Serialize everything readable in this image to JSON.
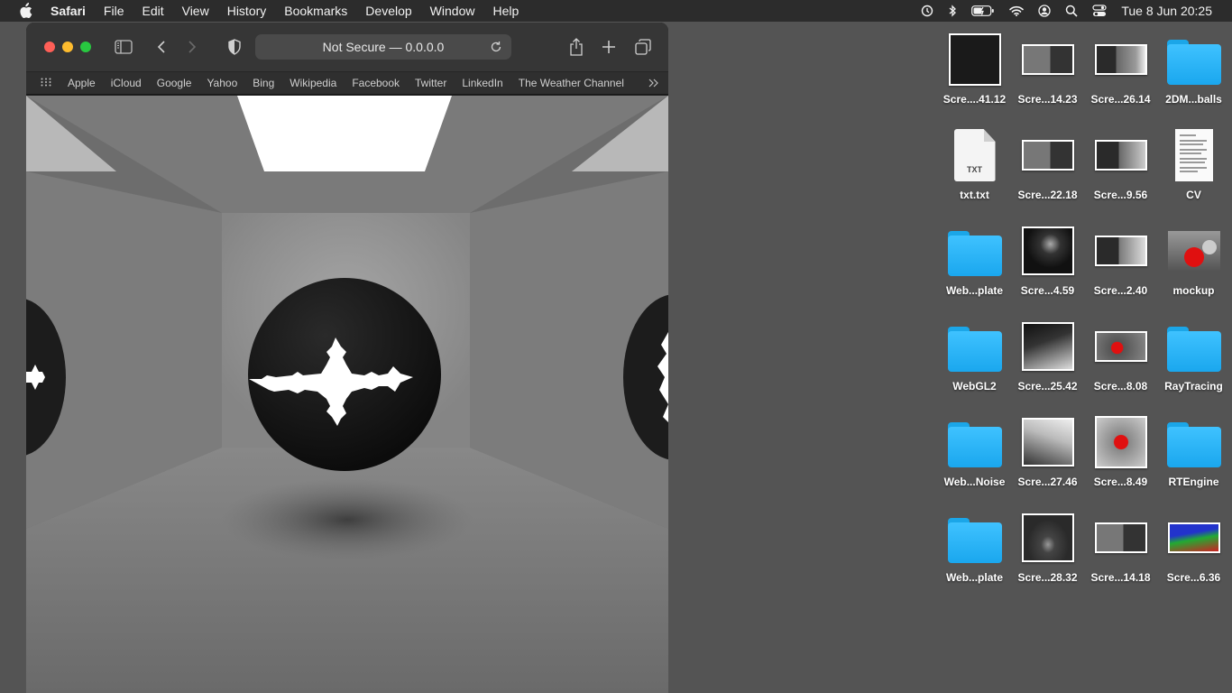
{
  "menubar": {
    "app_name": "Safari",
    "items": [
      "File",
      "Edit",
      "View",
      "History",
      "Bookmarks",
      "Develop",
      "Window",
      "Help"
    ],
    "status_icons": [
      "time-machine-icon",
      "bluetooth-icon",
      "battery-icon",
      "wifi-icon",
      "user-icon",
      "spotlight-icon",
      "control-center-icon"
    ],
    "clock": "Tue 8 Jun  20:25"
  },
  "safari": {
    "address": "Not Secure — 0.0.0.0",
    "favorites": [
      "Apple",
      "iCloud",
      "Google",
      "Yahoo",
      "Bing",
      "Wikipedia",
      "Facebook",
      "Twitter",
      "LinkedIn",
      "The Weather Channel"
    ]
  },
  "desktop": {
    "items": [
      {
        "label": "Scre....41.12",
        "kind": "screenshot-sq"
      },
      {
        "label": "Scre...14.23",
        "kind": "screenshot-wide"
      },
      {
        "label": "Scre...26.14",
        "kind": "screenshot-wide"
      },
      {
        "label": "2DM...balls",
        "kind": "folder"
      },
      {
        "label": "txt.txt",
        "kind": "text-file"
      },
      {
        "label": "Scre...22.18",
        "kind": "screenshot-wide"
      },
      {
        "label": "Scre...9.56",
        "kind": "screenshot-wide"
      },
      {
        "label": "CV",
        "kind": "document"
      },
      {
        "label": "Web...plate",
        "kind": "folder"
      },
      {
        "label": "Scre...4.59",
        "kind": "screenshot-sq"
      },
      {
        "label": "Scre...2.40",
        "kind": "screenshot-wide"
      },
      {
        "label": "mockup",
        "kind": "mockup"
      },
      {
        "label": "Web...plate",
        "kind": "folder"
      },
      {
        "label": "Scre...25.42",
        "kind": "screenshot-sq"
      },
      {
        "label": "Scre...8.08",
        "kind": "screenshot-wide"
      },
      {
        "label": "RayTracing",
        "kind": "folder"
      },
      {
        "label": "Web...Noise",
        "kind": "folder"
      },
      {
        "label": "Scre...27.46",
        "kind": "screenshot-sq"
      },
      {
        "label": "Scre...8.49",
        "kind": "screenshot-sq"
      },
      {
        "label": "RTEngine",
        "kind": "folder"
      },
      {
        "label": "Web...plate",
        "kind": "folder"
      },
      {
        "label": "Scre...28.32",
        "kind": "screenshot-sq"
      },
      {
        "label": "Scre...14.18",
        "kind": "screenshot-wide"
      },
      {
        "label": "Scre...6.36",
        "kind": "screenshot-wide"
      }
    ]
  },
  "desktop_fix": [
    "WebGL2"
  ],
  "colors": {
    "desktop_bg": "#545454",
    "menubar_bg": "#2c2c2c",
    "folder_blue": "#1aa7ee",
    "close": "#ff5f57",
    "minimize": "#febc2e",
    "maximize": "#28c840"
  }
}
